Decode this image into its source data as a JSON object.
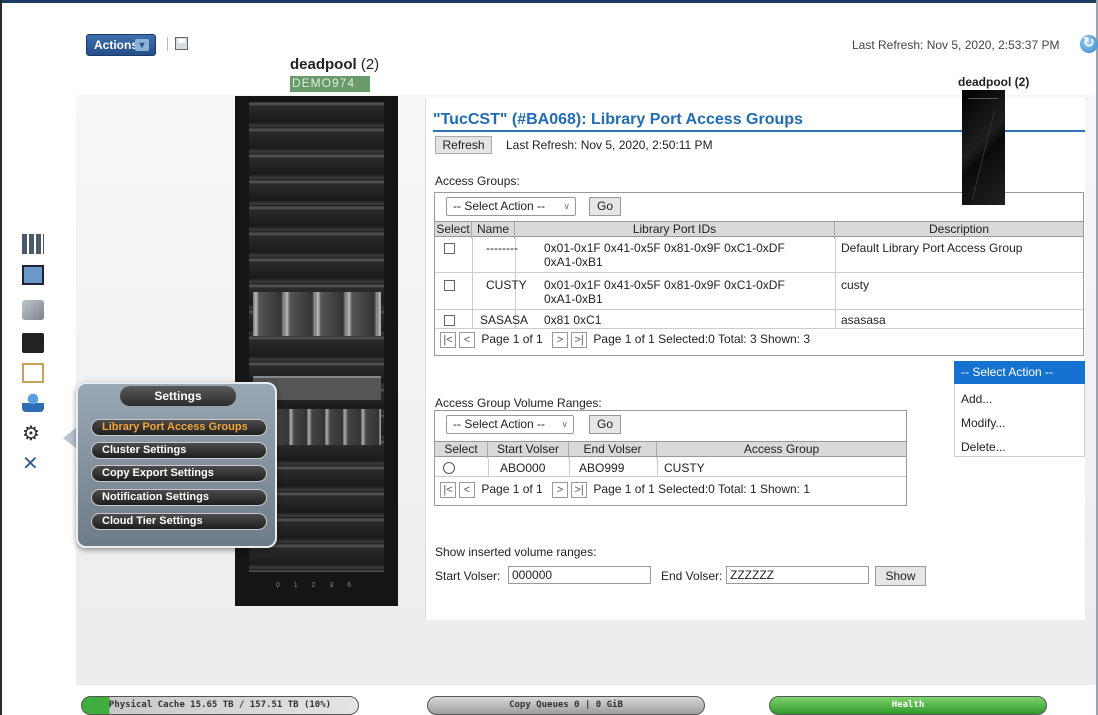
{
  "toolbar": {
    "actions_label": "Actions",
    "last_refresh": "Last Refresh:  Nov 5, 2020, 2:53:37 PM"
  },
  "cluster": {
    "name": "deadpool",
    "count": "(2)",
    "sub_label": "DEMO974",
    "rack_slots": "0 1 2 3 6"
  },
  "box": {
    "title": "deadpool (2)"
  },
  "settings": {
    "title": "Settings",
    "items": [
      {
        "label": "Library Port Access Groups",
        "active": true
      },
      {
        "label": "Cluster Settings"
      },
      {
        "label": "Copy Export Settings"
      },
      {
        "label": "Notification Settings"
      },
      {
        "label": "Cloud Tier Settings"
      }
    ]
  },
  "page": {
    "title": "\"TucCST\" (#BA068): Library Port Access Groups",
    "refresh_label": "Refresh",
    "last_refresh": "Last Refresh:  Nov 5, 2020, 2:50:11 PM"
  },
  "access_groups": {
    "label": "Access Groups:",
    "select_action": "-- Select Action --",
    "go_label": "Go",
    "headers": [
      "Select",
      "Name",
      "Library Port IDs",
      "Description"
    ],
    "rows": [
      {
        "name": "--------",
        "ids_1": "0x01-0x1F 0x41-0x5F 0x81-0x9F 0xC1-0xDF",
        "ids_2": "0xA1-0xB1",
        "description": "Default Library Port Access Group"
      },
      {
        "name": "CUSTY",
        "ids_1": "0x01-0x1F 0x41-0x5F 0x81-0x9F 0xC1-0xDF",
        "ids_2": "0xA1-0xB1",
        "description": "custy"
      },
      {
        "name": "SASASA",
        "ids_1": "0x81 0xC1",
        "ids_2": "",
        "description": "asasasa"
      }
    ],
    "pager": {
      "page_label": "Page 1 of 1",
      "summary": "Page 1 of 1 Selected:0 Total: 3 Shown: 3"
    }
  },
  "dropdown": {
    "selected": "-- Select Action --",
    "options": [
      "Add...",
      "Modify...",
      "Delete..."
    ]
  },
  "volume_ranges": {
    "label": "Access Group Volume Ranges:",
    "select_action": "-- Select Action --",
    "go_label": "Go",
    "headers": [
      "Select",
      "Start Volser",
      "End Volser",
      "Access Group"
    ],
    "rows": [
      {
        "start": "ABO000",
        "end": "ABO999",
        "group": "CUSTY"
      }
    ],
    "pager": {
      "page_label": "Page 1 of 1",
      "summary": "Page 1 of 1 Selected:0 Total: 1 Shown: 1"
    }
  },
  "inserted": {
    "label": "Show inserted volume ranges:",
    "start_label": "Start Volser:",
    "start_value": "000000",
    "end_label": "End Volser:",
    "end_value": "ZZZZZZ",
    "show_label": "Show"
  },
  "status": {
    "physical_cache": "Physical Cache 15.65 TB / 157.51 TB (10%)",
    "physical_cache_fraction": 0.1,
    "copy_queues": "Copy Queues 0 | 0 GiB",
    "health": "Health"
  },
  "colors": {
    "accent": "#1f6bb5",
    "highlight": "#1672d1",
    "active_item": "#f3a638",
    "healthy": "#3fae3f"
  }
}
